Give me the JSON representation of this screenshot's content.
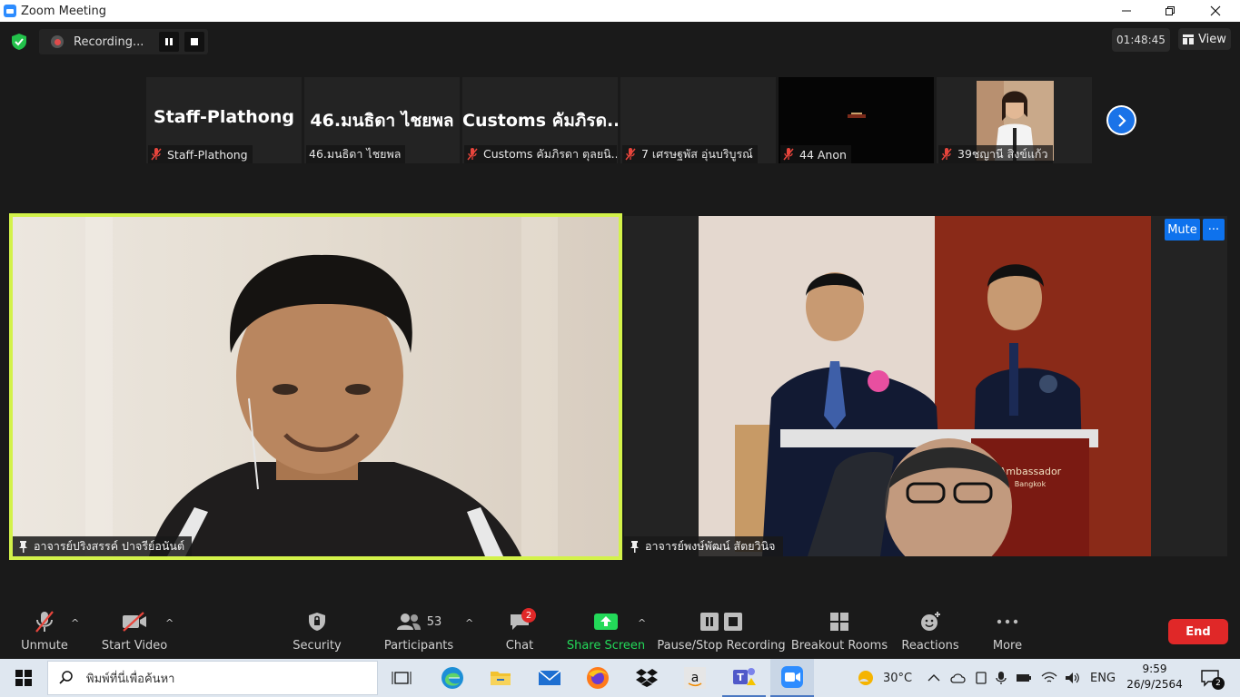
{
  "window": {
    "title": "Zoom Meeting"
  },
  "recording": {
    "label": "Recording..."
  },
  "timer": "01:48:45",
  "view_label": "View",
  "thumbnails": [
    {
      "big": "Staff-Plathong",
      "name": "Staff-Plathong",
      "muted": true
    },
    {
      "big": "46.มนธิดา ไชยพล",
      "name": "46.มนธิดา ไชยพล",
      "muted": false
    },
    {
      "big": "Customs คัมภิรด...",
      "name": "Customs คัมภิรดา ตุลยนิ...",
      "muted": true
    },
    {
      "big": "",
      "name": "7 เศรษฐพัส อุ่นบริบูรณ์",
      "muted": true
    },
    {
      "big": "",
      "name": "44 Anon",
      "muted": true
    },
    {
      "big": "",
      "name": "39ชญานี สิงข์แก้ว",
      "muted": true
    }
  ],
  "videos": {
    "left": {
      "name": "อาจารย์ปริงสรรค์ ปาจรีย์อนันต์"
    },
    "right": {
      "name": "อาจารย์พงษ์พัฒน์ สัตยวินิจ",
      "mute_label": "Mute",
      "more_label": "···",
      "podium_text": "Ambassador",
      "podium_subtext": "Bangkok"
    }
  },
  "toolbar": {
    "unmute": "Unmute",
    "start_video": "Start Video",
    "security": "Security",
    "participants": "Participants",
    "participants_count": "53",
    "chat": "Chat",
    "chat_badge": "2",
    "share_screen": "Share Screen",
    "pause_stop_recording": "Pause/Stop Recording",
    "breakout_rooms": "Breakout Rooms",
    "reactions": "Reactions",
    "more": "More",
    "end": "End",
    "caret": "^"
  },
  "taskbar": {
    "search_placeholder": "พิมพ์ที่นี่เพื่อค้นหา",
    "temperature": "30°C",
    "language": "ENG",
    "time": "9:59",
    "date": "26/9/2564",
    "notification_count": "2"
  },
  "colors": {
    "active_speaker_border": "#d3f24a",
    "zoom_blue": "#0e72ed",
    "share_green": "#23d959",
    "end_red": "#e02828"
  }
}
